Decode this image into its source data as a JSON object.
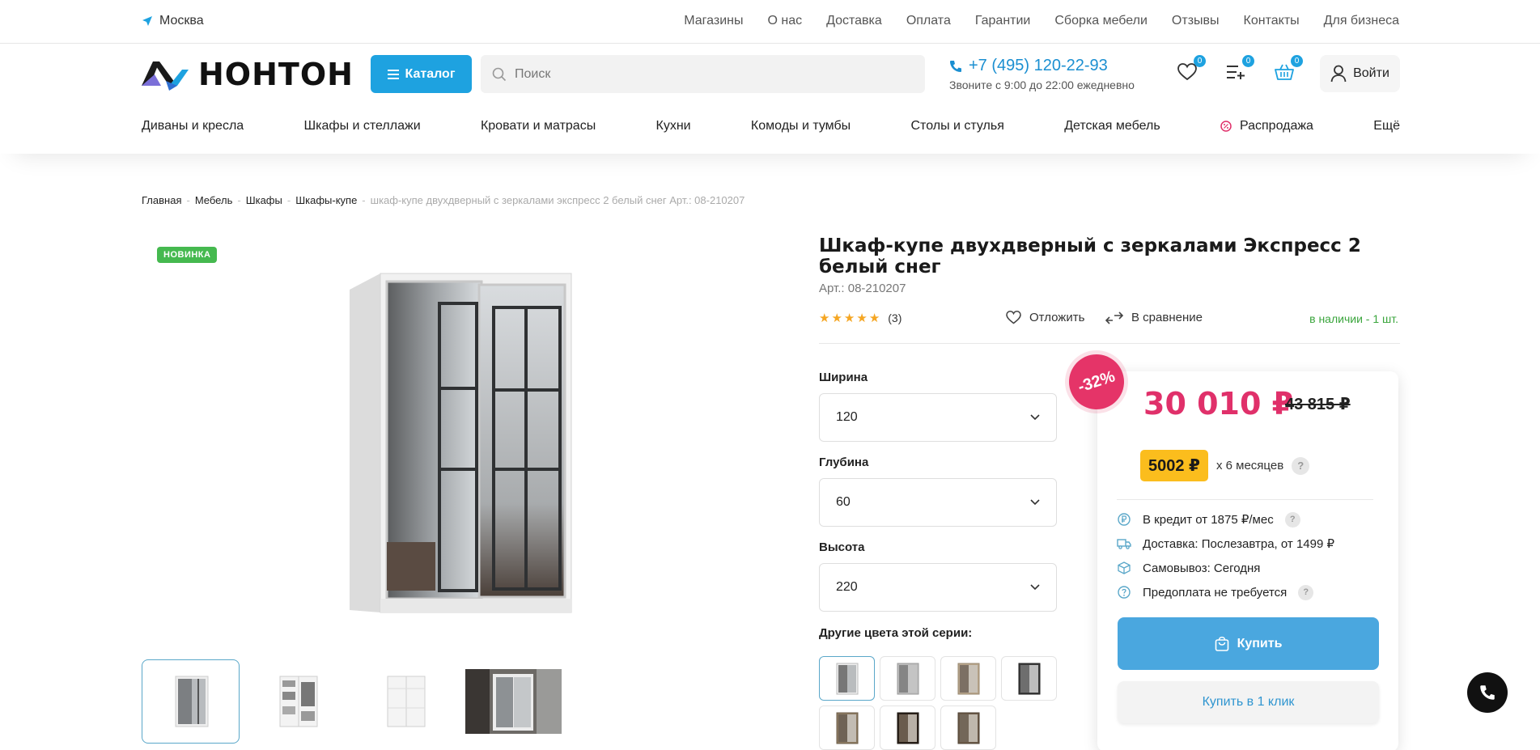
{
  "topbar": {
    "city": "Москва",
    "links": [
      "Магазины",
      "О нас",
      "Доставка",
      "Оплата",
      "Гарантии",
      "Сборка мебели",
      "Отзывы",
      "Контакты",
      "Для бизнеса"
    ]
  },
  "header": {
    "logo_text": "НОНТОН",
    "catalog_label": "Каталог",
    "search_placeholder": "Поиск",
    "phone": "+7 (495) 120-22-93",
    "phone_hours": "Звоните с 9:00 до 22:00 ежедневно",
    "favorites_count": "0",
    "compare_count": "0",
    "cart_count": "0",
    "login_label": "Войти"
  },
  "catnav": {
    "items": [
      "Диваны и кресла",
      "Шкафы и стеллажи",
      "Кровати и матрасы",
      "Кухни",
      "Комоды и тумбы",
      "Столы и стулья",
      "Детская мебель",
      "Распродажа",
      "Ещё"
    ]
  },
  "breadcrumb": {
    "items": [
      "Главная",
      "Мебель",
      "Шкафы",
      "Шкафы-купе"
    ],
    "current": "шкаф-купе двухдверный с зеркалами экспресс 2 белый снег Арт.: 08-210207"
  },
  "gallery": {
    "badge": "НОВИНКА"
  },
  "product": {
    "title": "Шкаф-купе двухдверный с зеркалами Экспресс 2 белый снег",
    "sku": "Арт.: 08-210207",
    "reviews_count": "(3)",
    "rating_value": 5,
    "wishlist_label": "Отложить",
    "compare_label": "В сравнение",
    "stock": "в наличии - 1 шт."
  },
  "options": {
    "width_label": "Ширина",
    "width_value": "120",
    "depth_label": "Глубина",
    "depth_value": "60",
    "height_label": "Высота",
    "height_value": "220",
    "colors_label": "Другие цвета этой серии:"
  },
  "pricing": {
    "discount": "-32%",
    "price": "30 010 ₽",
    "old_price": "43 815 ₽",
    "installment_amount": "5002 ₽",
    "installment_term": "x 6 месяцев",
    "features": [
      "В кредит от 1875 ₽/мес",
      "Доставка: Послезавтра, от 1499 ₽",
      "Самовывоз: Сегодня",
      "Предоплата не требуется"
    ],
    "buy_label": "Купить",
    "buy_one_click_label": "Купить в 1 клик"
  },
  "colors": {
    "accent": "#1ea2e0",
    "price": "#e0306a",
    "discount_badge": "#e53468",
    "installment_badge": "#fbbd1d",
    "in_stock": "#3aa53c",
    "new_badge": "#45b94f"
  }
}
